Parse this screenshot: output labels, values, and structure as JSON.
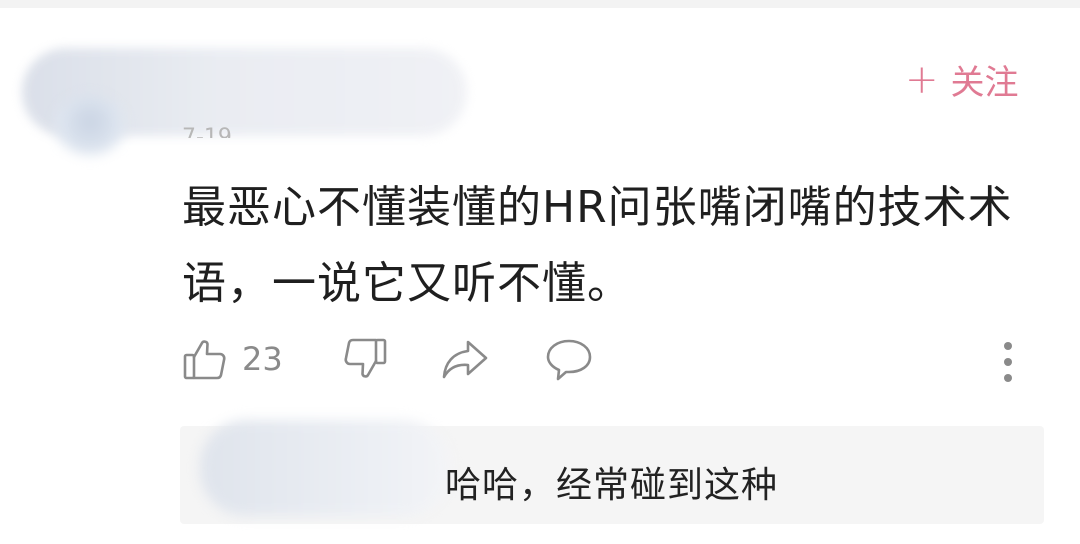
{
  "header": {
    "time_fragment": "7-19",
    "follow_label": "关注",
    "follow_plus": "+"
  },
  "comment": {
    "text": "最恶心不懂装懂的HR问张嘴闭嘴的技术术语，一说它又听不懂。"
  },
  "actions": {
    "like_count": "23"
  },
  "reply_preview": {
    "text": "哈哈，经常碰到这种"
  },
  "colors": {
    "follow": "#e07a93",
    "icon": "#8a8a8a",
    "reply_bg": "#f5f5f5"
  },
  "icons": [
    "thumbs-up-icon",
    "thumbs-down-icon",
    "share-icon",
    "comment-icon",
    "more-vertical-icon"
  ]
}
